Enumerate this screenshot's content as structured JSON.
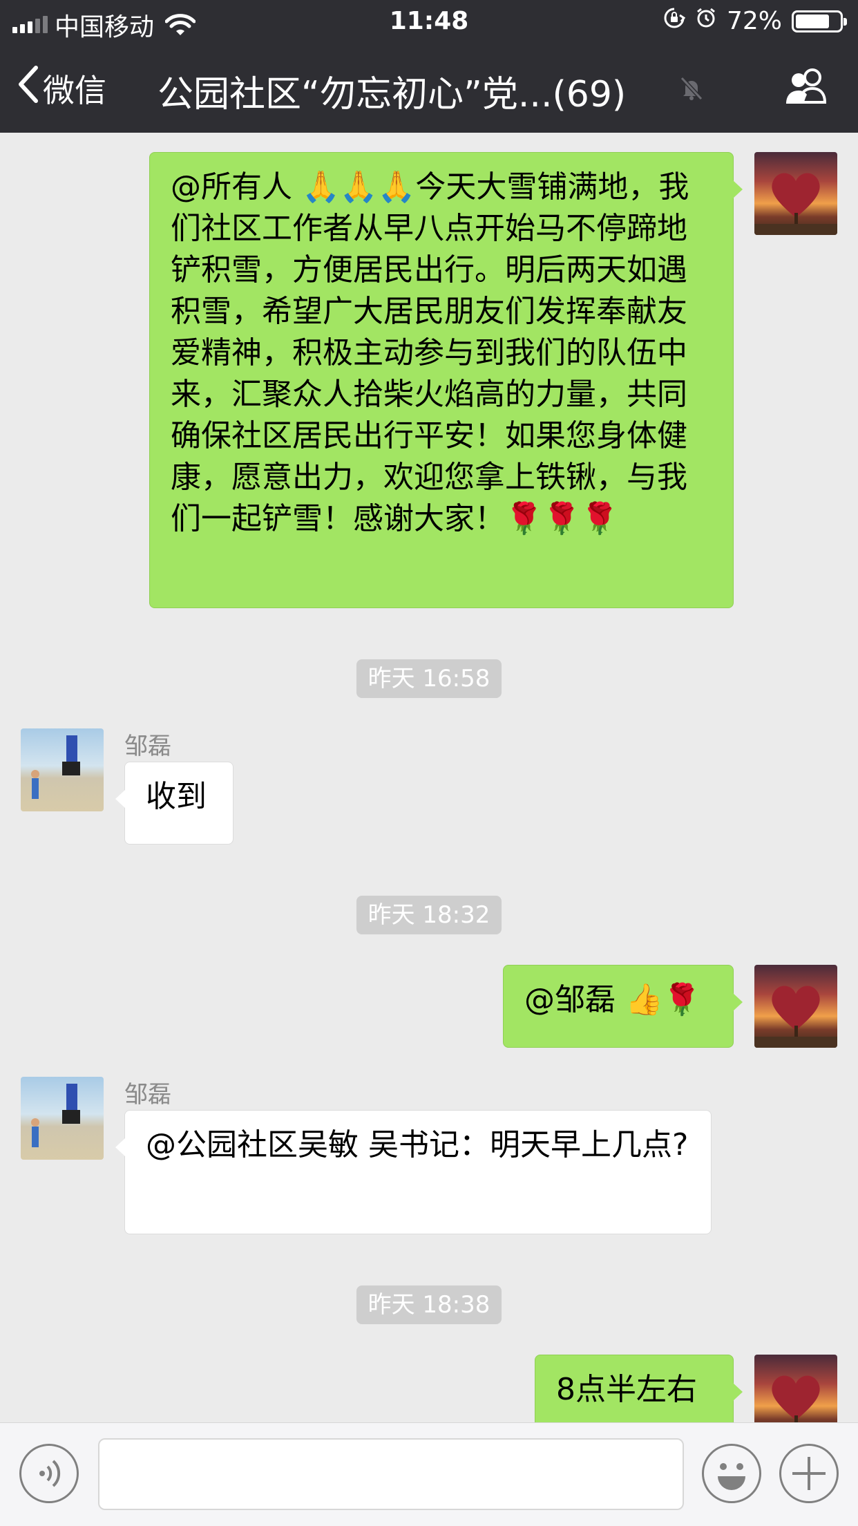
{
  "status_bar": {
    "carrier": "中国移动",
    "time": "11:48",
    "battery": "72%",
    "battery_level": 0.72
  },
  "nav": {
    "back_label": "微信",
    "title": "公园社区“勿忘初心”党...(69)"
  },
  "messages": {
    "m1": {
      "text": "@所有人 🙏🙏🙏今天大雪铺满地，我们社区工作者从早八点开始马不停蹄地铲积雪，方便居民出行。明后两天如遇积雪，希望广大居民朋友们发挥奉献友爱精神，积极主动参与到我们的队伍中来，汇聚众人拾柴火焰高的力量，共同确保社区居民出行平安！如果您身体健康，愿意出力，欢迎您拿上铁锹，与我们一起铲雪！感谢大家！🌹🌹🌹"
    },
    "t1": "昨天 16:58",
    "m2": {
      "sender": "邹磊",
      "text": "收到"
    },
    "t2": "昨天 18:32",
    "m3": {
      "text": "@邹磊 👍🌹"
    },
    "m4": {
      "sender": "邹磊",
      "text": "@公园社区吴敏 吴书记：明天早上几点?"
    },
    "t3": "昨天 18:38",
    "m5": {
      "text": "8点半左右"
    }
  },
  "icons": {
    "back": "chevron-left-icon",
    "mute": "bell-mute-icon",
    "group": "group-members-icon",
    "voice": "voice-icon",
    "emoji": "emoji-icon",
    "add": "plus-icon"
  },
  "colors": {
    "nav_bg": "#2e2e33",
    "chat_bg": "#ebebeb",
    "my_bubble": "#a2e563",
    "their_bubble": "#ffffff"
  }
}
